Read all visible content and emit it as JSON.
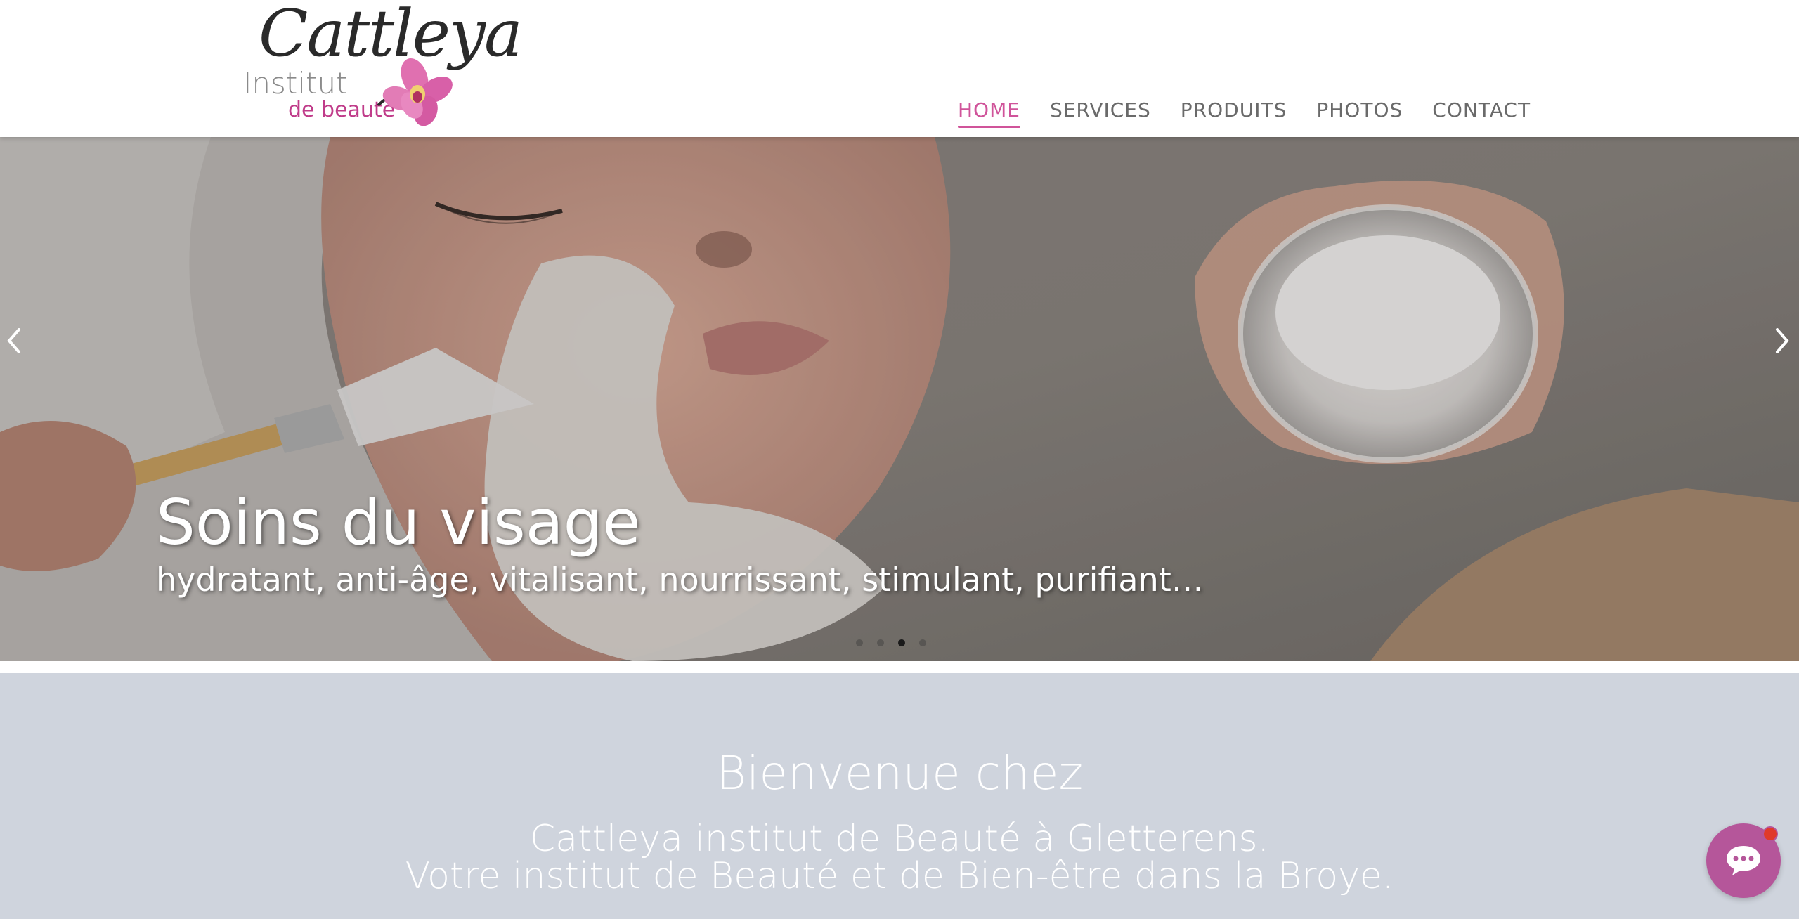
{
  "logo": {
    "script": "Cattleya",
    "institut": "Institut",
    "beaute": "de beauté"
  },
  "nav": {
    "items": [
      "HOME",
      "SERVICES",
      "PRODUITS",
      "PHOTOS",
      "CONTACT"
    ],
    "active": "HOME"
  },
  "hero": {
    "title": "Soins du visage",
    "subtitle": "hydratant, anti-âge, vitalisant, nourrissant, stimulant, purifiant…",
    "slide_count": 4,
    "active_slide": 3
  },
  "welcome": {
    "title": "Bienvenue chez",
    "line1": "Cattleya institut de Beauté à Gletterens.",
    "line2": "Votre institut de Beauté et de Bien-être dans la Broye."
  },
  "colors": {
    "accent": "#d0549a",
    "nav_text": "#6a6a6a",
    "welcome_bg": "#cfd4dd",
    "chat_bg": "#b5569a",
    "notification": "#e03a2a"
  },
  "icons": {
    "prev": "chevron-left-icon",
    "next": "chevron-right-icon",
    "chat": "chat-bubble-icon",
    "logo_flower": "orchid-icon"
  }
}
